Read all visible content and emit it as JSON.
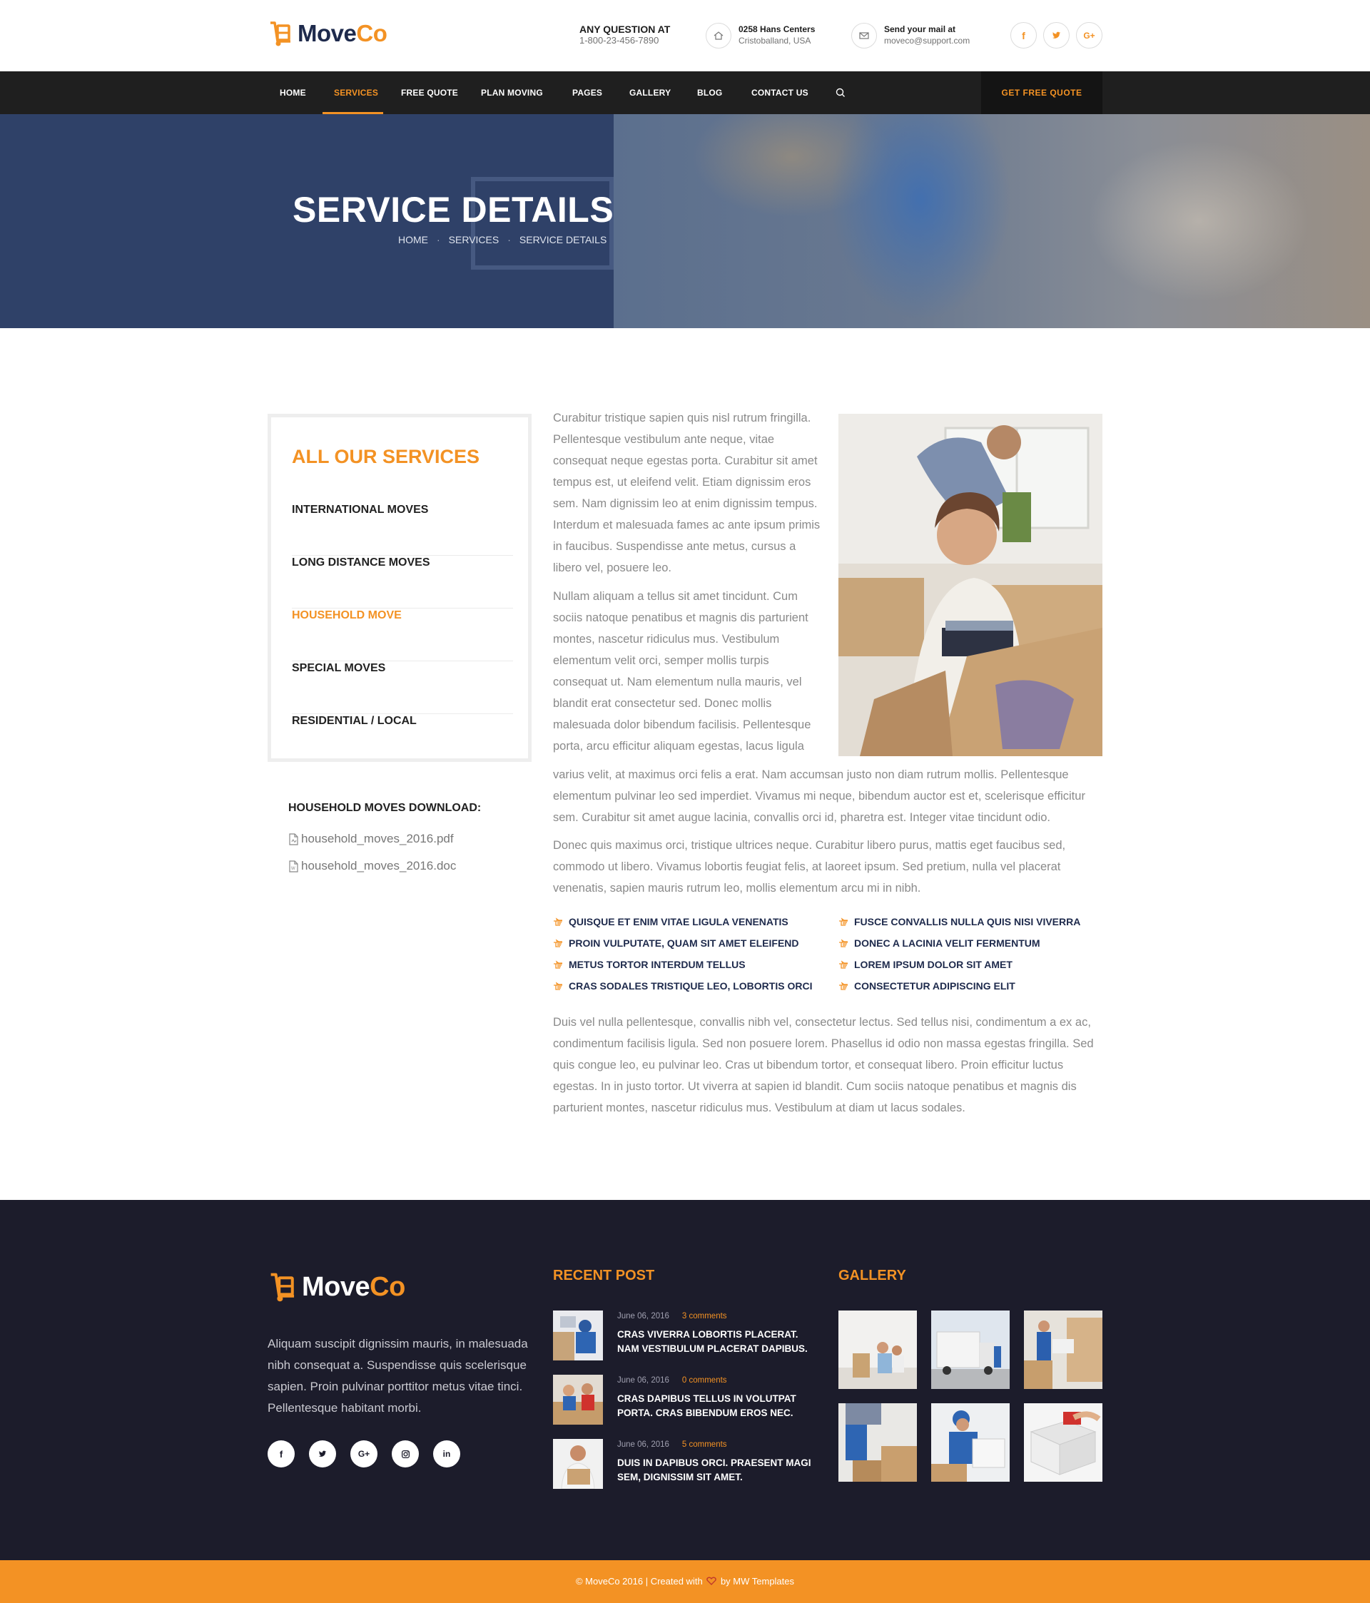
{
  "brand": {
    "name_part1": "Move",
    "name_part2": "Co",
    "accent": "#f39224",
    "navy": "#1e2a4c"
  },
  "header": {
    "question_label": "ANY QUESTION AT",
    "phone": "1-800-23-456-7890",
    "address_line1": "0258 Hans Centers",
    "address_line2": "Cristoballand, USA",
    "mail_label": "Send your mail at",
    "mail": "moveco@support.com",
    "social": [
      "f",
      "t",
      "G+"
    ]
  },
  "nav": {
    "items": [
      "HOME",
      "SERVICES",
      "FREE QUOTE",
      "PLAN MOVING",
      "PAGES",
      "GALLERY",
      "BLOG",
      "CONTACT US"
    ],
    "active": "SERVICES",
    "cta": "GET FREE QUOTE"
  },
  "hero": {
    "title": "SERVICE DETAILS",
    "breadcrumb": [
      "HOME",
      "SERVICES",
      "SERVICE DETAILS"
    ]
  },
  "sidebar": {
    "title": "ALL OUR SERVICES",
    "items": [
      "INTERNATIONAL MOVES",
      "LONG DISTANCE MOVES",
      "HOUSEHOLD MOVE",
      "SPECIAL MOVES",
      "RESIDENTIAL / LOCAL"
    ],
    "active": "HOUSEHOLD MOVE",
    "download_title": "HOUSEHOLD MOVES DOWNLOAD:",
    "downloads": [
      "household_moves_2016.pdf",
      "household_moves_2016.doc"
    ]
  },
  "content": {
    "p1": "Curabitur tristique sapien quis nisl rutrum fringilla. Pellentesque vestibulum ante neque, vitae consequat neque egestas porta. Curabitur sit amet tempus est, ut eleifend velit. Etiam dignissim eros sem. Nam dignissim leo at enim dignissim tempus. Interdum et malesuada fames ac ante ipsum primis in faucibus. Suspendisse ante metus, cursus a libero vel, posuere leo.",
    "p2a": "Nullam aliquam a tellus sit amet tincidunt. Cum sociis natoque penatibus et magnis dis parturient montes, nascetur ridiculus mus. Vestibulum elementum velit orci, semper mollis turpis consequat ut. Nam elementum nulla mauris, vel blandit erat consectetur sed. Donec mollis malesuada dolor bibendum facilisis. Pellentesque porta, arcu efficitur aliquam egestas, lacus ligula",
    "p2b": "varius velit, at maximus orci felis a erat. Nam accumsan justo non diam rutrum mollis. Pellentesque elementum pulvinar leo sed imperdiet. Vivamus mi neque, bibendum auctor est et, scelerisque efficitur sem. Curabitur sit amet augue lacinia, convallis orci id, pharetra est. Integer vitae tincidunt odio.",
    "p3": "Donec quis maximus orci, tristique ultrices neque. Curabitur libero purus, mattis eget faucibus sed, commodo ut libero. Vivamus lobortis feugiat felis, at laoreet ipsum. Sed pretium, nulla vel placerat venenatis, sapien mauris rutrum leo, mollis elementum arcu mi in nibh.",
    "bullets_left": [
      "QUISQUE ET ENIM VITAE LIGULA VENENATIS",
      "PROIN VULPUTATE, QUAM SIT AMET ELEIFEND",
      "METUS TORTOR INTERDUM TELLUS",
      "CRAS SODALES TRISTIQUE LEO, LOBORTIS ORCI"
    ],
    "bullets_right": [
      "FUSCE CONVALLIS NULLA QUIS NISI VIVERRA",
      "DONEC A LACINIA VELIT FERMENTUM",
      "LOREM IPSUM DOLOR SIT AMET",
      "CONSECTETUR ADIPISCING ELIT"
    ],
    "p4": "Duis vel nulla pellentesque, convallis nibh vel, consectetur lectus. Sed tellus nisi, condimentum a ex ac, condimentum facilisis ligula. Sed non posuere lorem. Phasellus id odio non massa egestas fringilla. Sed quis congue leo, eu pulvinar leo. Cras ut bibendum tortor, et consequat libero. Proin efficitur luctus egestas. In in justo tortor. Ut viverra at sapien id blandit. Cum sociis natoque penatibus et magnis dis parturient montes, nascetur ridiculus mus. Vestibulum at diam ut lacus sodales."
  },
  "footer": {
    "about": "Aliquam suscipit dignissim mauris, in malesuada nibh consequat a. Suspendisse quis scelerisque sapien. Proin pulvinar porttitor metus vitae tinci. Pellentesque habitant morbi.",
    "social": [
      "f",
      "t",
      "G+",
      "ig",
      "in"
    ],
    "recent_title": "RECENT POST",
    "posts": [
      {
        "date": "June 06, 2016",
        "comments": "3 comments",
        "title": "CRAS VIVERRA LOBORTIS PLACERAT. NAM VESTIBULUM PLACERAT DAPIBUS."
      },
      {
        "date": "June 06, 2016",
        "comments": "0 comments",
        "title": "CRAS DAPIBUS TELLUS IN VOLUTPAT PORTA. CRAS BIBENDUM EROS NEC."
      },
      {
        "date": "June 06, 2016",
        "comments": "5 comments",
        "title": "DUIS IN DAPIBUS ORCI. PRAESENT MAGI SEM, DIGNISSIM SIT AMET."
      }
    ],
    "gallery_title": "GALLERY",
    "copyright_pre": "© MoveCo 2016 | Created with",
    "copyright_post": "by MW Templates"
  }
}
